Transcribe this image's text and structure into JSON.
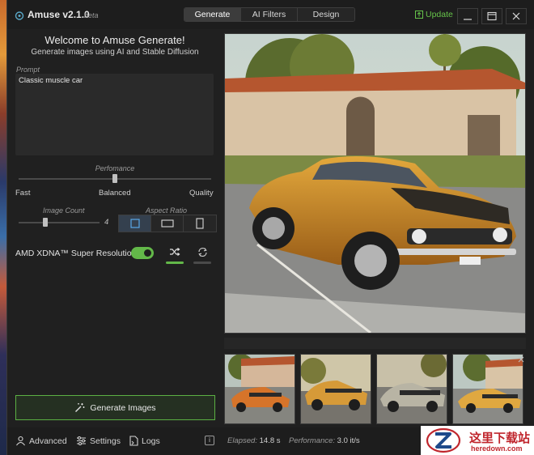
{
  "app": {
    "title": "Amuse v2.1.0",
    "beta": "beta"
  },
  "tabs": [
    {
      "label": "Generate",
      "active": true
    },
    {
      "label": "AI Filters",
      "active": false
    },
    {
      "label": "Design",
      "active": false
    }
  ],
  "update": {
    "label": "Update"
  },
  "left": {
    "welcome": "Welcome to Amuse Generate!",
    "subtitle": "Generate images using AI and Stable Diffusion",
    "prompt_label": "Prompt",
    "prompt_value": "Classic muscle car",
    "performance": {
      "label": "Perfomance",
      "fast": "Fast",
      "balanced": "Balanced",
      "quality": "Quality",
      "selected": "Balanced"
    },
    "image_count": {
      "label": "Image Count",
      "value": "4"
    },
    "aspect_ratio": {
      "label": "Aspect Ratio",
      "options": [
        "square",
        "landscape",
        "portrait"
      ],
      "selected": "square"
    },
    "xdna": {
      "label": "AMD XDNA™ Super Resolution",
      "enabled": true
    },
    "generate_button": "Generate Images"
  },
  "bottom": {
    "advanced": "Advanced",
    "settings": "Settings",
    "logs": "Logs",
    "elapsed_label": "Elapsed:",
    "elapsed_value": "14.8 s",
    "performance_label": "Performance:",
    "performance_value": "3.0 it/s"
  },
  "watermark": {
    "cn": "这里下载站",
    "en": "heredown.com"
  },
  "colors": {
    "accent": "#63b849",
    "background": "#202020",
    "watermark_red": "#c0262d"
  }
}
